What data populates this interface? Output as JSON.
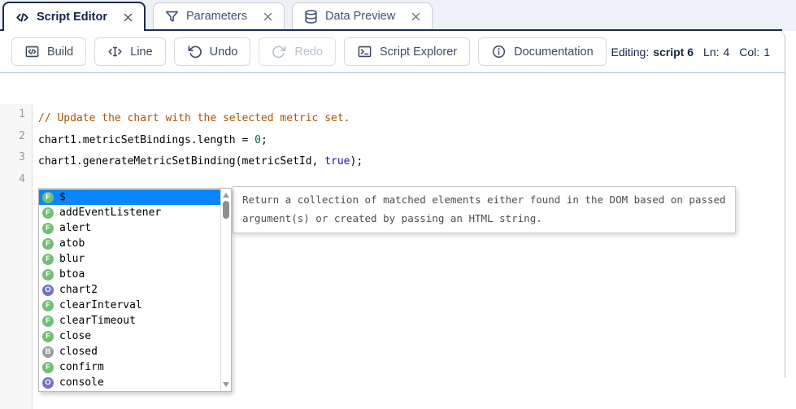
{
  "tabs": [
    {
      "label": "Script Editor",
      "icon": "code",
      "active": true
    },
    {
      "label": "Parameters",
      "icon": "filter",
      "active": false
    },
    {
      "label": "Data Preview",
      "icon": "database",
      "active": false
    }
  ],
  "toolbar": {
    "buttons": [
      {
        "label": "Build",
        "icon": "build",
        "disabled": false
      },
      {
        "label": "Line",
        "icon": "line",
        "disabled": false
      },
      {
        "label": "Undo",
        "icon": "undo",
        "disabled": false
      },
      {
        "label": "Redo",
        "icon": "redo",
        "disabled": true
      },
      {
        "label": "Script Explorer",
        "icon": "terminal",
        "disabled": false
      },
      {
        "label": "Documentation",
        "icon": "info",
        "disabled": false
      }
    ],
    "status": {
      "editing_label": "Editing:",
      "script_name": "script 6",
      "ln_label": "Ln:",
      "ln": "4",
      "col_label": "Col:",
      "col": "1"
    }
  },
  "editor": {
    "lines": [
      {
        "number": "1",
        "segments": [
          {
            "text": "// Update the chart with the selected metric set.",
            "type": "comment"
          }
        ]
      },
      {
        "number": "2",
        "segments": [
          {
            "text": "chart1.metricSetBindings.length = ",
            "type": "plain"
          },
          {
            "text": "0",
            "type": "number"
          },
          {
            "text": ";",
            "type": "plain"
          }
        ]
      },
      {
        "number": "3",
        "segments": [
          {
            "text": "chart1.generateMetricSetBinding(metricSetId, ",
            "type": "plain"
          },
          {
            "text": "true",
            "type": "atom"
          },
          {
            "text": ");",
            "type": "plain"
          }
        ]
      },
      {
        "number": "4",
        "segments": []
      }
    ]
  },
  "autocomplete": {
    "items": [
      {
        "label": "$",
        "kind": "F",
        "selected": true
      },
      {
        "label": "addEventListener",
        "kind": "F",
        "selected": false
      },
      {
        "label": "alert",
        "kind": "F",
        "selected": false
      },
      {
        "label": "atob",
        "kind": "F",
        "selected": false
      },
      {
        "label": "blur",
        "kind": "F",
        "selected": false
      },
      {
        "label": "btoa",
        "kind": "F",
        "selected": false
      },
      {
        "label": "chart2",
        "kind": "O",
        "selected": false
      },
      {
        "label": "clearInterval",
        "kind": "F",
        "selected": false
      },
      {
        "label": "clearTimeout",
        "kind": "F",
        "selected": false
      },
      {
        "label": "close",
        "kind": "F",
        "selected": false
      },
      {
        "label": "closed",
        "kind": "B",
        "selected": false
      },
      {
        "label": "confirm",
        "kind": "F",
        "selected": false
      },
      {
        "label": "console",
        "kind": "O",
        "selected": false
      }
    ]
  },
  "tooltip": {
    "line1": "Return a collection of matched elements either found in the DOM based on passed",
    "line2": "argument(s) or created by passing an HTML string."
  },
  "colors": {
    "selection": "#0b85ff",
    "tab_active_border": "#1e2b4d",
    "kind_colors": {
      "F": "#72bf72",
      "O": "#7173c4",
      "B": "#9e9e9e"
    },
    "token_colors": {
      "plain": "#000000",
      "comment": "#aa5500",
      "number": "#116644",
      "atom": "#221199"
    }
  }
}
